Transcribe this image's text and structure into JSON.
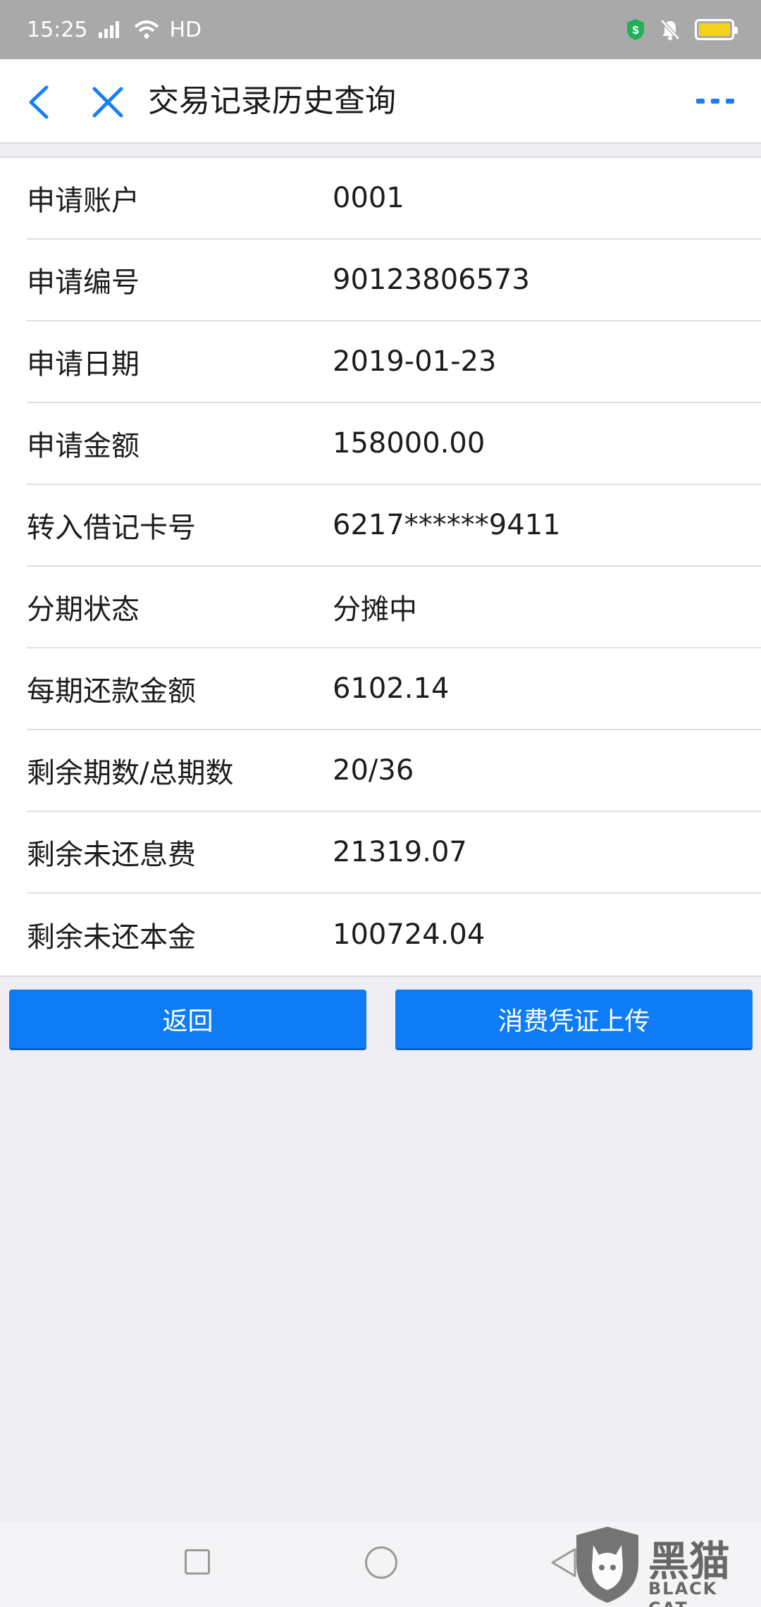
{
  "status_bar": {
    "time": "15:25",
    "network_label": "HD",
    "battery_color": "#f5d21a"
  },
  "header": {
    "title": "交易记录历史查询",
    "icons": [
      "back-icon",
      "close-icon",
      "more-icon"
    ]
  },
  "details": [
    {
      "label": "申请账户",
      "value": "0001"
    },
    {
      "label": "申请编号",
      "value": "90123806573"
    },
    {
      "label": "申请日期",
      "value": "2019-01-23"
    },
    {
      "label": "申请金额",
      "value": "158000.00"
    },
    {
      "label": "转入借记卡号",
      "value": "6217******9411"
    },
    {
      "label": "分期状态",
      "value": "分摊中"
    },
    {
      "label": "每期还款金额",
      "value": "6102.14"
    },
    {
      "label": "剩余期数/总期数",
      "value": "20/36"
    },
    {
      "label": "剩余未还息费",
      "value": "21319.07"
    },
    {
      "label": "剩余未还本金",
      "value": "100724.04"
    }
  ],
  "buttons": {
    "back_label": "返回",
    "upload_label": "消费凭证上传"
  },
  "watermark": {
    "cn": "黑猫",
    "en": "BLACK CAT"
  },
  "colors": {
    "accent": "#0e7cf7",
    "background": "#eeeef3"
  }
}
